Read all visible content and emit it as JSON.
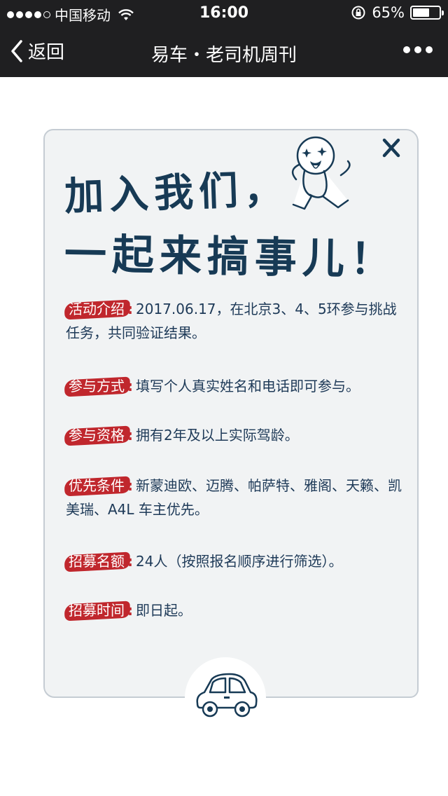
{
  "statusbar": {
    "carrier": "中国移动",
    "time": "16:00",
    "battery": "65%",
    "battery_level": 0.65
  },
  "navbar": {
    "back_label": "返回",
    "title": "易车・老司机周刊"
  },
  "card": {
    "headline_line1": "加入我们，",
    "headline_line2": "一起来搞事儿！",
    "items": [
      {
        "tag": "活动介绍",
        "text": "2017.06.17，在北京3、4、5环参与挑战任务，共同验证结果。"
      },
      {
        "tag": "参与方式",
        "text": "填写个人真实姓名和电话即可参与。"
      },
      {
        "tag": "参与资格",
        "text": "拥有2年及以上实际驾龄。"
      },
      {
        "tag": "优先条件",
        "text": "新蒙迪欧、迈腾、帕萨特、雅阁、天籁、凯美瑞、A4L 车主优先。"
      },
      {
        "tag": "招募名额",
        "text": "24人（按照报名顺序进行筛选）。"
      },
      {
        "tag": "招募时间",
        "text": "即日起。"
      }
    ]
  },
  "colors": {
    "bar": "#1f1f21",
    "tag": "#c0272d",
    "text": "#1e3a58",
    "headline": "#173a55",
    "card_bg": "#f1f3f4"
  }
}
